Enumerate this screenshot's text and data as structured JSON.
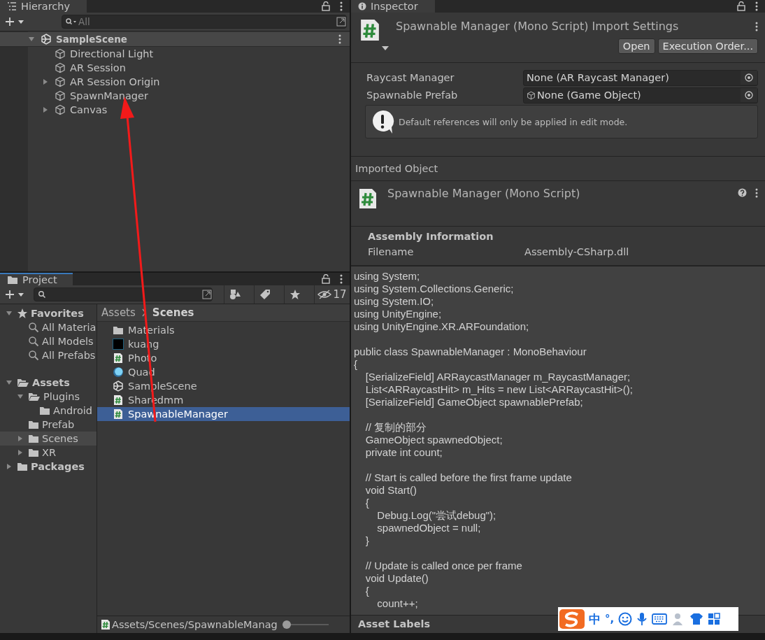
{
  "hierarchy": {
    "title": "Hierarchy",
    "search": {
      "placeholder": "All"
    },
    "scene": {
      "name": "SampleScene",
      "expanded": true,
      "children": [
        {
          "name": "Directional Light"
        },
        {
          "name": "AR Session"
        },
        {
          "name": "AR Session Origin",
          "expanded": false
        },
        {
          "name": "SpawnManager"
        },
        {
          "name": "Canvas",
          "expanded": false
        }
      ]
    }
  },
  "project": {
    "title": "Project",
    "hidden_count": "17",
    "sidebar": [
      {
        "label": "Favorites",
        "kind": "group",
        "expanded": true,
        "selected": false,
        "children": [
          {
            "label": "All Materia",
            "kind": "search",
            "selected": false
          },
          {
            "label": "All Models",
            "kind": "search",
            "selected": false
          },
          {
            "label": "All Prefabs",
            "kind": "search",
            "selected": false
          }
        ]
      },
      {
        "label": "Assets",
        "kind": "group",
        "expanded": true,
        "selected": false,
        "children": [
          {
            "label": "Plugins",
            "kind": "openfolder",
            "expanded": true,
            "selected": false,
            "children": [
              {
                "label": "Android",
                "kind": "folder",
                "selected": false
              }
            ]
          },
          {
            "label": "Prefab",
            "kind": "folder",
            "selected": false
          },
          {
            "label": "Scenes",
            "kind": "folder",
            "expanded": false,
            "selected": true
          },
          {
            "label": "XR",
            "kind": "folder",
            "expanded": false,
            "selected": false
          }
        ]
      },
      {
        "label": "Packages",
        "kind": "group",
        "expanded": false,
        "selected": false
      }
    ],
    "breadcrumb": [
      "Assets",
      "Scenes"
    ],
    "files": [
      {
        "name": "Materials",
        "kind": "folder",
        "selected": false
      },
      {
        "name": "kuang",
        "kind": "texture",
        "selected": false
      },
      {
        "name": "Photo",
        "kind": "script",
        "selected": false
      },
      {
        "name": "Quad",
        "kind": "material",
        "selected": false
      },
      {
        "name": "SampleScene",
        "kind": "scene",
        "selected": false
      },
      {
        "name": "Sharedmm",
        "kind": "script",
        "selected": false
      },
      {
        "name": "SpawnableManager",
        "kind": "script",
        "selected": true
      }
    ],
    "path": "Assets/Scenes/SpawnableManag",
    "zoom": {
      "level": 0
    }
  },
  "inspector": {
    "title": "Inspector",
    "header": "Spawnable Manager (Mono Script) Import Settings",
    "buttons": [
      "Open",
      "Execution Order..."
    ],
    "fields": [
      {
        "label": "Raycast Manager",
        "value": "None (AR Raycast Manager)",
        "kind": "plain"
      },
      {
        "label": "Spawnable Prefab",
        "value": "None (Game Object)",
        "kind": "gameobject"
      }
    ],
    "help": "Default references will only be applied in edit mode.",
    "section": "Imported Object",
    "object_title": "Spawnable Manager (Mono Script)",
    "assembly": {
      "heading": "Assembly Information",
      "rows": [
        {
          "label": "Filename",
          "value": "Assembly-CSharp.dll"
        }
      ]
    },
    "code": [
      {
        "text": "using System;"
      },
      {
        "text": "using System.Collections.Generic;"
      },
      {
        "text": "using System.IO;"
      },
      {
        "text": "using UnityEngine;"
      },
      {
        "text": "using UnityEngine.XR.ARFoundation;"
      },
      {
        "text": "public class SpawnableManager : MonoBehaviour",
        "blank_before": true
      },
      {
        "text": "{"
      },
      {
        "text": "    [SerializeField] ARRaycastManager m_RaycastManager;"
      },
      {
        "text": "    List<ARRaycastHit> m_Hits = new List<ARRaycastHit>();"
      },
      {
        "text": "    [SerializeField] GameObject spawnablePrefab;"
      },
      {
        "text": "    // 复制的部分",
        "blank_before": true
      },
      {
        "text": "    GameObject spawnedObject;"
      },
      {
        "text": "    private int count;"
      },
      {
        "text": "    // Start is called before the first frame update",
        "blank_before": true
      },
      {
        "text": "    void Start()"
      },
      {
        "text": "    {"
      },
      {
        "text": "        Debug.Log(\"尝试debug\");"
      },
      {
        "text": "        spawnedObject = null;"
      },
      {
        "text": "    }"
      },
      {
        "text": "    // Update is called once per frame",
        "blank_before": true
      },
      {
        "text": "    void Update()"
      },
      {
        "text": "    {"
      },
      {
        "text": "        count++;"
      }
    ],
    "footer": "Asset Labels"
  },
  "ime": {
    "mode": "中",
    "punctuation": "°,"
  }
}
